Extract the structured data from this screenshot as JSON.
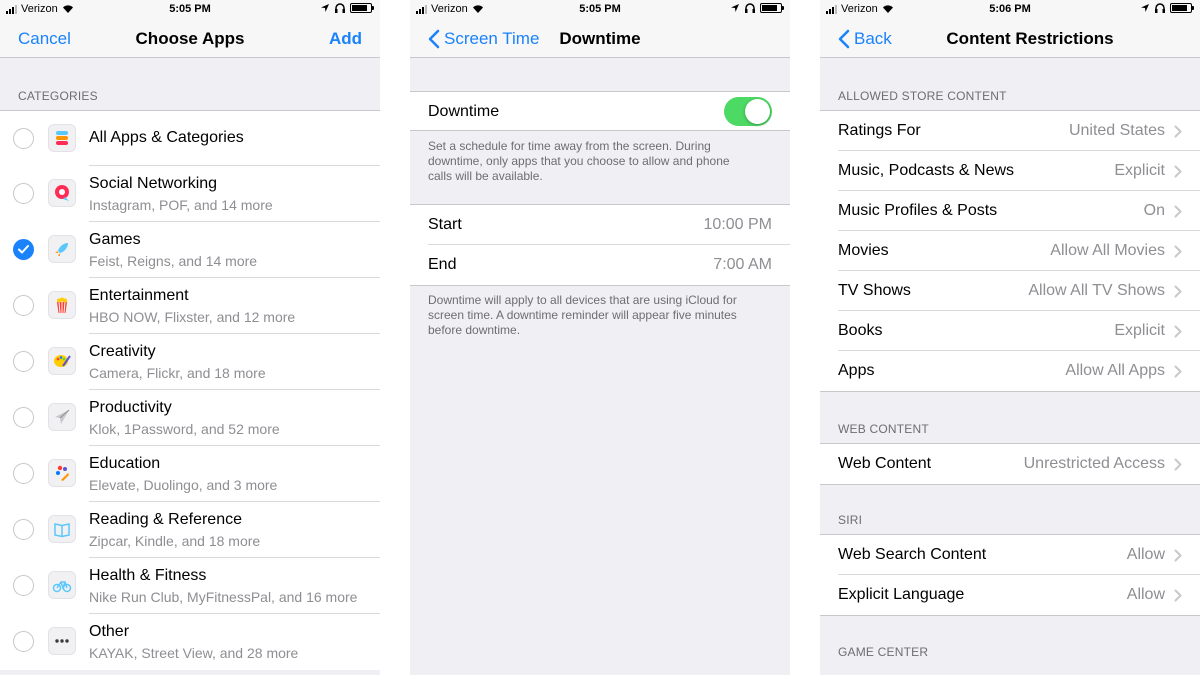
{
  "panel1": {
    "status": {
      "carrier": "Verizon",
      "time": "5:05 PM"
    },
    "nav": {
      "cancel": "Cancel",
      "title": "Choose Apps",
      "add": "Add"
    },
    "section": "CATEGORIES",
    "categories": [
      {
        "title": "All Apps & Categories",
        "subtitle": "",
        "icon": "stack-icon",
        "checked": false
      },
      {
        "title": "Social Networking",
        "subtitle": "Instagram, POF, and 14 more",
        "icon": "chat-bubble-icon",
        "checked": false
      },
      {
        "title": "Games",
        "subtitle": "Feist, Reigns, and 14 more",
        "icon": "rocket-icon",
        "checked": true
      },
      {
        "title": "Entertainment",
        "subtitle": "HBO NOW, Flixster, and 12 more",
        "icon": "popcorn-icon",
        "checked": false
      },
      {
        "title": "Creativity",
        "subtitle": "Camera, Flickr, and 18 more",
        "icon": "palette-icon",
        "checked": false
      },
      {
        "title": "Productivity",
        "subtitle": "Klok, 1Password, and 52 more",
        "icon": "paper-plane-icon",
        "checked": false
      },
      {
        "title": "Education",
        "subtitle": "Elevate, Duolingo, and 3 more",
        "icon": "education-icon",
        "checked": false
      },
      {
        "title": "Reading & Reference",
        "subtitle": "Zipcar, Kindle, and 18 more",
        "icon": "book-icon",
        "checked": false
      },
      {
        "title": "Health & Fitness",
        "subtitle": "Nike Run Club, MyFitnessPal, and 16 more",
        "icon": "bicycle-icon",
        "checked": false
      },
      {
        "title": "Other",
        "subtitle": "KAYAK, Street View, and 28 more",
        "icon": "ellipsis-icon",
        "checked": false
      }
    ]
  },
  "panel2": {
    "status": {
      "carrier": "Verizon",
      "time": "5:05 PM"
    },
    "nav": {
      "back": "Screen Time",
      "title": "Downtime"
    },
    "toggle_label": "Downtime",
    "toggle_on": true,
    "description": "Set a schedule for time away from the screen. During downtime, only apps that you choose to allow and phone calls will be available.",
    "start_label": "Start",
    "start_value": "10:00 PM",
    "end_label": "End",
    "end_value": "7:00 AM",
    "footer": "Downtime will apply to all devices that are using iCloud for screen time. A downtime reminder will appear five minutes before downtime."
  },
  "panel3": {
    "status": {
      "carrier": "Verizon",
      "time": "5:06 PM"
    },
    "nav": {
      "back": "Back",
      "title": "Content Restrictions"
    },
    "sections": [
      {
        "header": "ALLOWED STORE CONTENT",
        "rows": [
          {
            "label": "Ratings For",
            "value": "United States"
          },
          {
            "label": "Music, Podcasts & News",
            "value": "Explicit"
          },
          {
            "label": "Music Profiles & Posts",
            "value": "On"
          },
          {
            "label": "Movies",
            "value": "Allow All Movies"
          },
          {
            "label": "TV Shows",
            "value": "Allow All TV Shows"
          },
          {
            "label": "Books",
            "value": "Explicit"
          },
          {
            "label": "Apps",
            "value": "Allow All Apps"
          }
        ]
      },
      {
        "header": "WEB CONTENT",
        "rows": [
          {
            "label": "Web Content",
            "value": "Unrestricted Access"
          }
        ]
      },
      {
        "header": "SIRI",
        "rows": [
          {
            "label": "Web Search Content",
            "value": "Allow"
          },
          {
            "label": "Explicit Language",
            "value": "Allow"
          }
        ]
      },
      {
        "header": "GAME CENTER",
        "rows": []
      }
    ]
  },
  "colors": {
    "accent": "#1a82fb",
    "toggle_on": "#4cd964",
    "secondary_text": "#8e8e93",
    "background": "#efeff4"
  }
}
